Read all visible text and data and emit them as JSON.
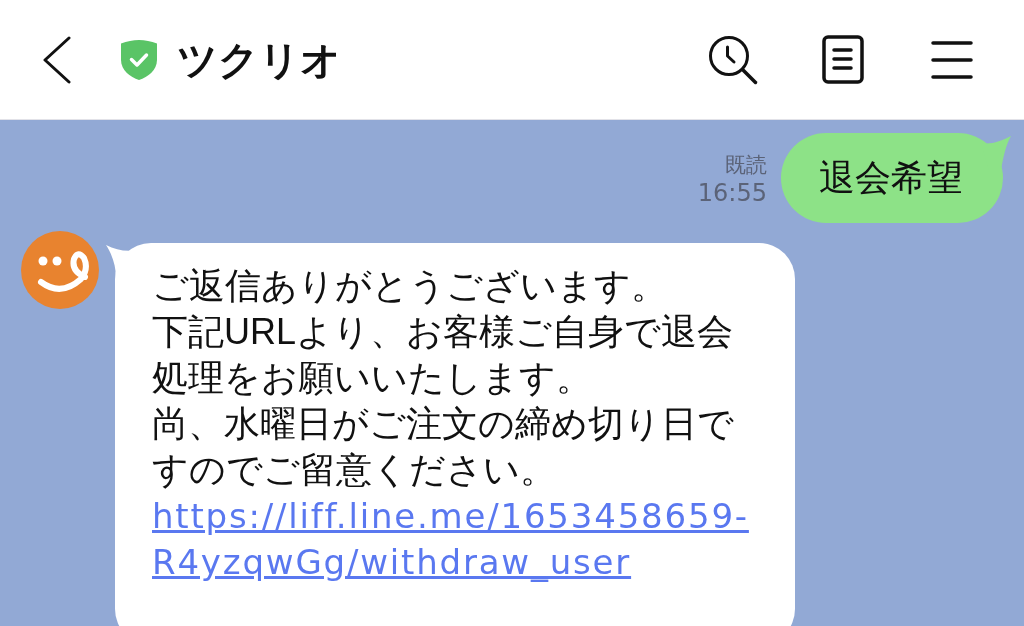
{
  "header": {
    "title": "ツクリオ",
    "verified": true
  },
  "messages": [
    {
      "kind": "sent",
      "text": "退会希望",
      "read_label": "既読",
      "time": "16:55"
    },
    {
      "kind": "received",
      "lines": [
        "ご返信ありがとうございます。",
        "下記URLより、お客様ご自身で退会",
        "処理をお願いいたします。",
        "尚、水曜日がご注文の締め切り日で",
        "すのでご留意ください。"
      ],
      "link": "https://liff.line.me/1653458659-R4yzqwGg/withdraw_user"
    }
  ]
}
